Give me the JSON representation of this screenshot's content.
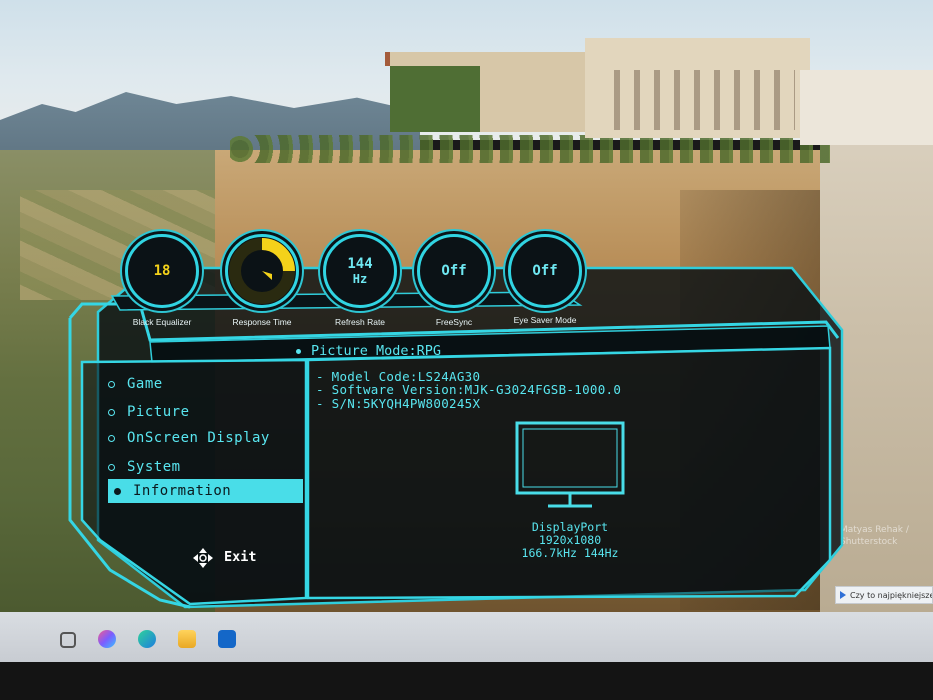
{
  "gauges": [
    {
      "id": "black-equalizer",
      "value": "18",
      "unit": "",
      "label": "Black Equalizer"
    },
    {
      "id": "response-time",
      "value": "",
      "unit": "",
      "label": "Response Time",
      "level": 0.25
    },
    {
      "id": "refresh-rate",
      "value": "144",
      "unit": "Hz",
      "label": "Refresh Rate"
    },
    {
      "id": "freesync",
      "value": "Off",
      "unit": "",
      "label": "FreeSync"
    },
    {
      "id": "eye-saver",
      "value": "Off",
      "unit": "",
      "label": "Eye Saver Mode"
    }
  ],
  "picture_mode": {
    "label": "Picture Mode:",
    "value": "RPG"
  },
  "menu": {
    "items": [
      {
        "label": "Game"
      },
      {
        "label": "Picture"
      },
      {
        "label": "OnScreen Display"
      },
      {
        "label": "System"
      },
      {
        "label": "Information",
        "selected": true
      }
    ],
    "exit_label": "Exit"
  },
  "info": {
    "model_code": "- Model Code:LS24AG30",
    "software_version": "- Software Version:MJK-G3024FGSB-1000.0",
    "serial": "- S/N:5KYQH4PW800245X"
  },
  "connection": {
    "input": "DisplayPort",
    "resolution": "1920x1080",
    "frequency": "166.7kHz 144Hz"
  },
  "notification": {
    "text": "Czy to najpiękniejsze..."
  },
  "watermark": {
    "line1": "Matyas Rehak /",
    "line2": "Shutterstock"
  },
  "colors": {
    "osd_cyan": "#4fe3ee",
    "gauge_yellow": "#f4d21a",
    "osd_bg": "#0b1216",
    "selected_bg": "#49dde8"
  }
}
